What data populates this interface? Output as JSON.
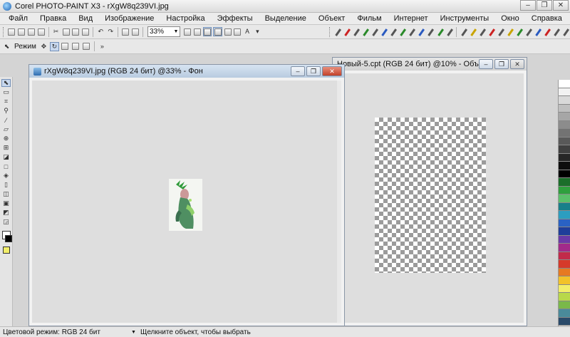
{
  "app": {
    "title": "Corel PHOTO-PAINT X3 - rXgW8q239VI.jpg",
    "minimize": "–",
    "maximize": "❐",
    "close": "✕"
  },
  "menu": [
    {
      "id": "file",
      "label": "Файл"
    },
    {
      "id": "edit",
      "label": "Правка"
    },
    {
      "id": "view",
      "label": "Вид"
    },
    {
      "id": "image",
      "label": "Изображение"
    },
    {
      "id": "adjust",
      "label": "Настройка"
    },
    {
      "id": "effects",
      "label": "Эффекты"
    },
    {
      "id": "mask",
      "label": "Выделение"
    },
    {
      "id": "object",
      "label": "Объект"
    },
    {
      "id": "movie",
      "label": "Фильм"
    },
    {
      "id": "web",
      "label": "Интернет"
    },
    {
      "id": "tools",
      "label": "Инструменты"
    },
    {
      "id": "window",
      "label": "Окно"
    },
    {
      "id": "help",
      "label": "Справка"
    }
  ],
  "toolbar": {
    "zoom_value": "33%",
    "mode_label": "Режим"
  },
  "documents": [
    {
      "id": "doc1",
      "title": "rXgW8q239VI.jpg (RGB 24 бит) @33% - Фон"
    },
    {
      "id": "doc2",
      "title": "Новый-5.cpt (RGB 24 бит) @10% - Объ..."
    }
  ],
  "palette": [
    "#ffffff",
    "#f2f2f2",
    "#d9d9d9",
    "#bfbfbf",
    "#a6a6a6",
    "#8c8c8c",
    "#737373",
    "#595959",
    "#404040",
    "#262626",
    "#0d0d0d",
    "#000000",
    "#1b6e2a",
    "#2fa03d",
    "#5bc06a",
    "#18808a",
    "#2c9ec0",
    "#2a62c4",
    "#1f3e9a",
    "#6a3aa8",
    "#a22a8a",
    "#c22a4a",
    "#d63a2a",
    "#e67a22",
    "#f2c22a",
    "#f2ee6a",
    "#b8d84a",
    "#7ab84a",
    "#4a8a9a",
    "#2a4a6a"
  ],
  "colors": {
    "accent": "#7390b8",
    "fill_color": "#f2ee6a"
  },
  "status": {
    "color_mode": "Цветовой режим: RGB 24 бит",
    "hint": "Щелкните объект, чтобы выбрать"
  }
}
